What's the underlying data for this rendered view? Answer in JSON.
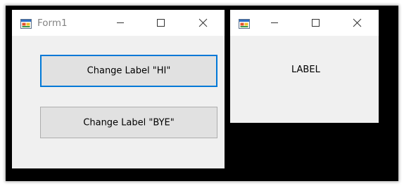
{
  "form1": {
    "title": "Form1",
    "button_hi": "Change Label \"HI\"",
    "button_bye": "Change Label \"BYE\""
  },
  "form2": {
    "title": "",
    "label": "LABEL"
  },
  "colors": {
    "backdrop": "#000000",
    "window_bg": "#f0f0f0",
    "titlebar_bg": "#ffffff",
    "title_text": "#838383",
    "button_bg": "#e1e1e1",
    "button_border": "#adadad",
    "focus_border": "#0078d7"
  },
  "icons": {
    "app": "winforms-app-icon",
    "minimize": "minimize-icon",
    "maximize": "maximize-icon",
    "close": "close-icon"
  }
}
